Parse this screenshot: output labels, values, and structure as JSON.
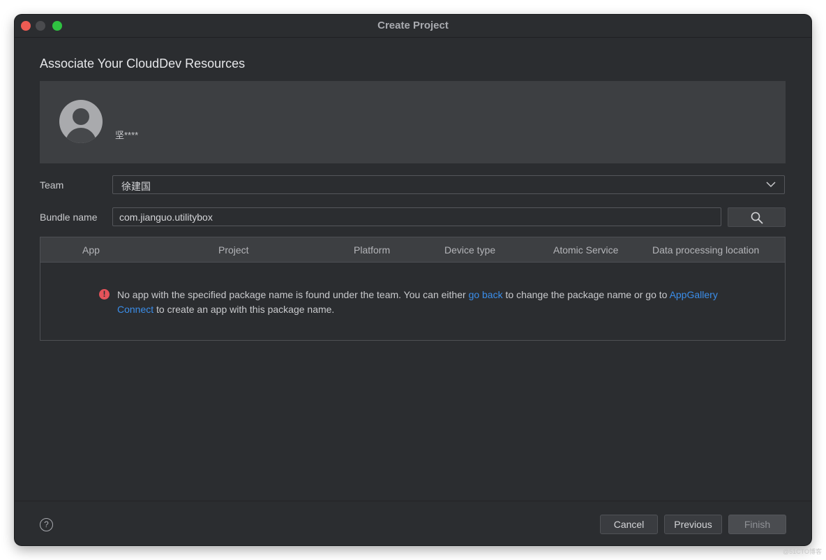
{
  "window": {
    "title": "Create Project"
  },
  "page": {
    "heading": "Associate Your CloudDev Resources"
  },
  "account": {
    "name": "坚****"
  },
  "team": {
    "label": "Team",
    "value": "徐建国"
  },
  "bundle": {
    "label": "Bundle name",
    "value": "com.jianguo.utilitybox"
  },
  "table": {
    "columns": [
      "App",
      "Project",
      "Platform",
      "Device type",
      "Atomic Service",
      "Data processing location"
    ]
  },
  "message": {
    "text_1": "No app with the specified package name is found under the team. You can either ",
    "link_1": "go back",
    "text_2": " to change the package name or go to ",
    "link_2": "AppGallery Connect",
    "text_3": " to create an app with this package name."
  },
  "footer": {
    "help": "?",
    "cancel_label": "Cancel",
    "previous_label": "Previous",
    "finish_label": "Finish"
  },
  "watermark": "@51CTO博客",
  "colors": {
    "window_bg": "#2b2d30",
    "panel_bg": "#3d3f42",
    "link": "#3b8eea",
    "error": "#e5535a",
    "close": "#ee5b53",
    "maximize": "#2fc241"
  }
}
